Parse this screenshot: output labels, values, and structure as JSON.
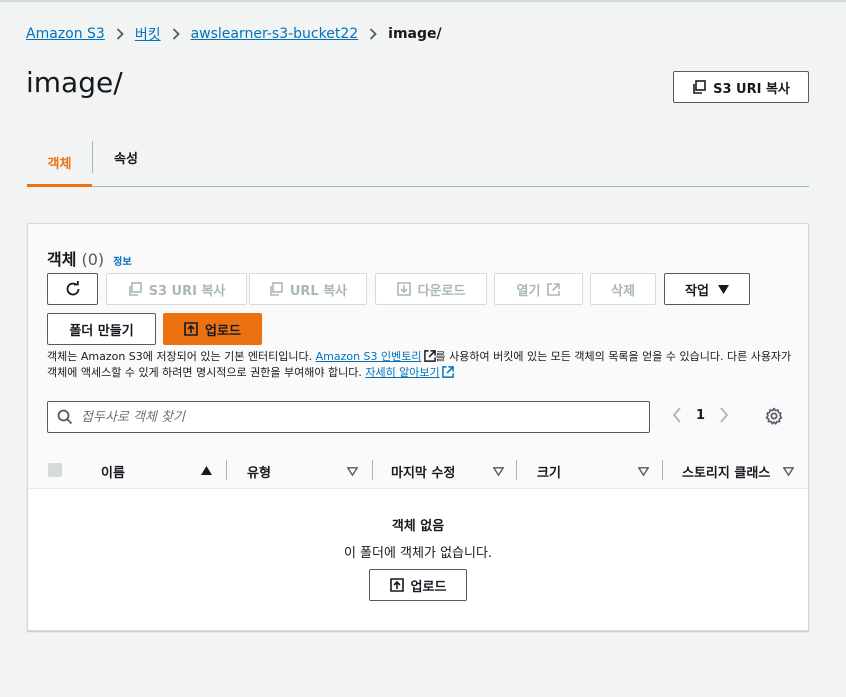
{
  "breadcrumb": {
    "items": [
      "Amazon S3",
      "버킷",
      "awslearner-s3-bucket22"
    ],
    "current": "image/"
  },
  "page": {
    "title": "image/",
    "copy_uri_label": "S3 URI 복사"
  },
  "tabs": [
    {
      "label": "객체",
      "active": true
    },
    {
      "label": "속성",
      "active": false
    }
  ],
  "objects_panel": {
    "title": "객체",
    "count": "(0)",
    "info_link": "정보",
    "toolbar": {
      "refresh_icon": "refresh-icon",
      "copy_s3_uri": "S3 URI 복사",
      "copy_url": "URL 복사",
      "download": "다운로드",
      "open": "열기",
      "delete": "삭제",
      "actions": "작업",
      "create_folder": "폴더 만들기",
      "upload": "업로드"
    },
    "description": {
      "part1": "객체는 Amazon S3에 저장되어 있는 기본 엔터티입니다. ",
      "link1": "Amazon S3 인벤토리",
      "part2": "를 사용하여 버킷에 있는 모든 객체의 목록을 얻을 수 있습니다. 다른 사용자가 객체에 액세스할 수 있게 하려면 명시적으로 권한을 부여해야 합니다. ",
      "link2": "자세히 알아보기"
    },
    "search_placeholder": "접두사로 객체 찾기",
    "page_number": "1",
    "columns": [
      "이름",
      "유형",
      "마지막 수정",
      "크기",
      "스토리지 클래스"
    ],
    "empty_title": "객체 없음",
    "empty_message": "이 폴더에 객체가 없습니다.",
    "empty_upload": "업로드"
  },
  "colors": {
    "accent": "#ec7211",
    "link": "#0073bb",
    "background": "#f2f3f3"
  }
}
